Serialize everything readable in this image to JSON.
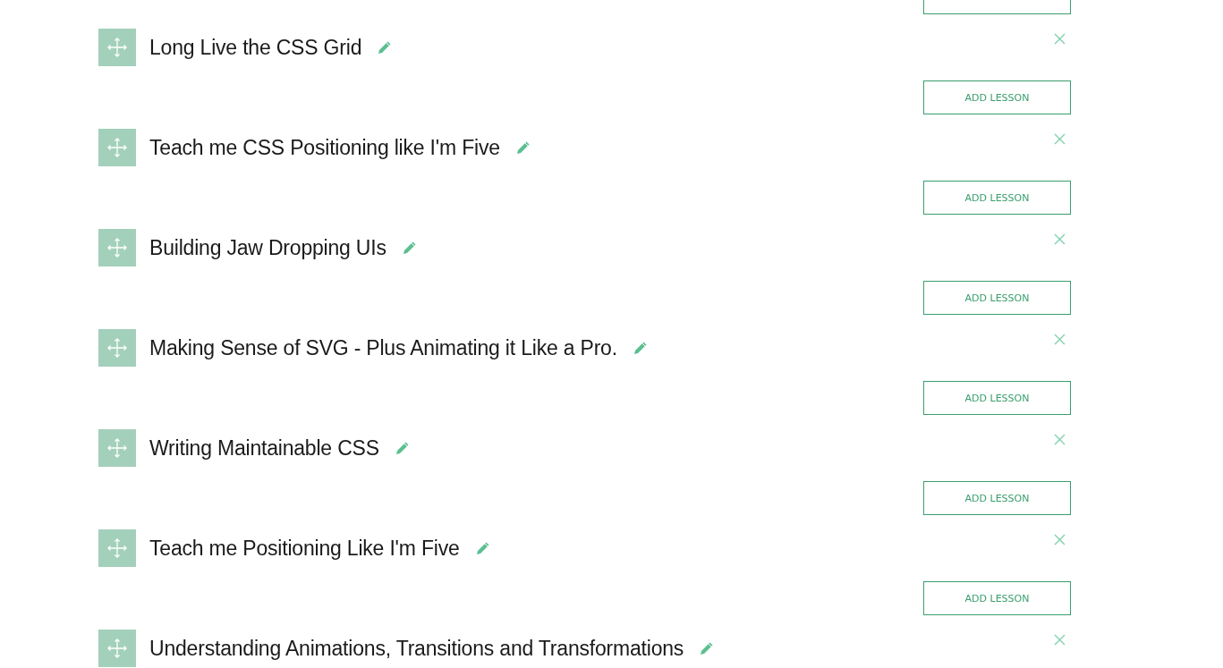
{
  "modules": [
    {
      "title": "Long Live the CSS Grid",
      "add_button": "ADD LESSON"
    },
    {
      "title": "Teach me CSS Positioning like I'm Five",
      "add_button": "ADD LESSON"
    },
    {
      "title": "Building Jaw Dropping UIs",
      "add_button": "ADD LESSON"
    },
    {
      "title": "Making Sense of SVG - Plus Animating it Like a Pro.",
      "add_button": "ADD LESSON"
    },
    {
      "title": "Writing Maintainable CSS",
      "add_button": "ADD LESSON"
    },
    {
      "title": "Teach me Positioning Like I'm Five",
      "add_button": "ADD LESSON"
    },
    {
      "title": "Understanding Animations, Transitions and Transformations"
    }
  ]
}
